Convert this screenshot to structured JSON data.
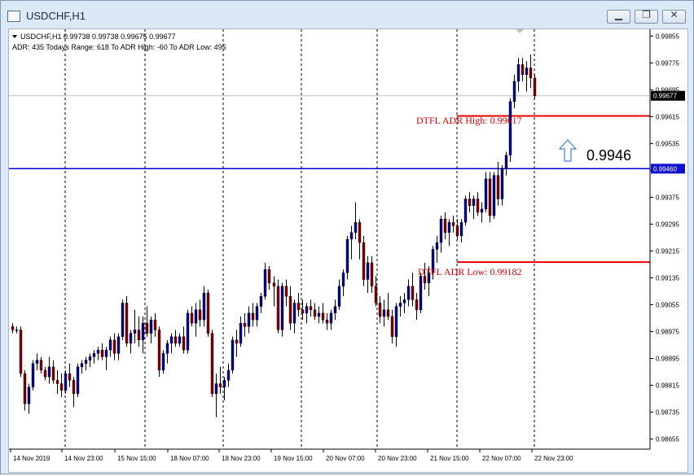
{
  "window": {
    "title": "USDCHF,H1"
  },
  "info": {
    "symbol_line": "USDCHF,H1  0.99738 0.99738 0.99675 0.99677",
    "adr_line": "ADR: 435  Todays Range: 618  To ADR High: -60  To ADR Low: 495"
  },
  "annotations": {
    "adr_high_label": "DTFL ADR High: 0.99617",
    "adr_low_label": "DTFL ADR Low: 0.99182",
    "level_label": "0.9946"
  },
  "colors": {
    "bull": "#000080",
    "bear": "#800000",
    "adr_line": "#e00000",
    "level_line": "#0000cc",
    "grid": "#000000"
  },
  "icons": {
    "target_arrow": "up-arrow-icon"
  },
  "chart_data": {
    "type": "candlestick",
    "symbol": "USDCHF",
    "timeframe": "H1",
    "ylim": [
      0.98625,
      0.99875
    ],
    "y_ticks": [
      "0.99855",
      "0.99775",
      "0.99695",
      "0.99615",
      "0.99535",
      "0.99455",
      "0.99375",
      "0.99295",
      "0.99215",
      "0.99135",
      "0.99055",
      "0.98975",
      "0.98895",
      "0.98815",
      "0.98735",
      "0.98655"
    ],
    "x_tick_labels": [
      "14 Nov 2019",
      "14 Nov 23:00",
      "15 Nov 15:00",
      "18 Nov 07:00",
      "18 Nov 23:00",
      "19 Nov 15:00",
      "20 Nov 07:00",
      "20 Nov 23:00",
      "21 Nov 15:00",
      "22 Nov 07:00",
      "22 Nov 23:00"
    ],
    "current_price": 0.99677,
    "current_price_label": "0.99677",
    "horizontal_level": 0.9946,
    "horizontal_level_label": "0.99460",
    "adr_high": 0.99617,
    "adr_low": 0.99182,
    "series": [
      {
        "values": [
          [
            0.9899,
            0.99,
            0.9897,
            0.9898
          ],
          [
            0.9898,
            0.9899,
            0.9897,
            0.9898
          ],
          [
            0.9898,
            0.9899,
            0.9884,
            0.9885
          ],
          [
            0.9885,
            0.9886,
            0.9874,
            0.9876
          ],
          [
            0.9876,
            0.9882,
            0.9873,
            0.9881
          ],
          [
            0.9881,
            0.9889,
            0.988,
            0.9888
          ],
          [
            0.9888,
            0.9891,
            0.9886,
            0.9889
          ],
          [
            0.9889,
            0.989,
            0.9885,
            0.9886
          ],
          [
            0.9886,
            0.9887,
            0.9883,
            0.9884
          ],
          [
            0.9884,
            0.989,
            0.9882,
            0.9887
          ],
          [
            0.9887,
            0.9889,
            0.9882,
            0.9883
          ],
          [
            0.9883,
            0.9886,
            0.9879,
            0.9882
          ],
          [
            0.9882,
            0.9885,
            0.9878,
            0.988
          ],
          [
            0.988,
            0.9886,
            0.9879,
            0.9885
          ],
          [
            0.9885,
            0.9888,
            0.9881,
            0.9883
          ],
          [
            0.9883,
            0.9884,
            0.9875,
            0.9879
          ],
          [
            0.9879,
            0.9888,
            0.9878,
            0.9887
          ],
          [
            0.9887,
            0.9889,
            0.9885,
            0.9888
          ],
          [
            0.9888,
            0.989,
            0.9886,
            0.9889
          ],
          [
            0.9889,
            0.9891,
            0.9887,
            0.989
          ],
          [
            0.989,
            0.9892,
            0.9888,
            0.9891
          ],
          [
            0.9891,
            0.9893,
            0.9889,
            0.9892
          ],
          [
            0.9892,
            0.9894,
            0.9889,
            0.989
          ],
          [
            0.989,
            0.9893,
            0.9886,
            0.9892
          ],
          [
            0.9892,
            0.9896,
            0.989,
            0.9895
          ],
          [
            0.9895,
            0.9897,
            0.9889,
            0.9891
          ],
          [
            0.9891,
            0.9897,
            0.9889,
            0.9896
          ],
          [
            0.9896,
            0.9907,
            0.9895,
            0.9906
          ],
          [
            0.9906,
            0.9908,
            0.9893,
            0.9894
          ],
          [
            0.9894,
            0.9898,
            0.9891,
            0.9897
          ],
          [
            0.9897,
            0.9904,
            0.9894,
            0.9898
          ],
          [
            0.9898,
            0.9902,
            0.9893,
            0.9895
          ],
          [
            0.9895,
            0.9902,
            0.9891,
            0.99
          ],
          [
            0.99,
            0.9905,
            0.9896,
            0.9897
          ],
          [
            0.9897,
            0.9902,
            0.9894,
            0.9901
          ],
          [
            0.9901,
            0.9903,
            0.9896,
            0.9898
          ],
          [
            0.9898,
            0.9899,
            0.9884,
            0.9886
          ],
          [
            0.9886,
            0.9892,
            0.9885,
            0.9891
          ],
          [
            0.9891,
            0.9895,
            0.9888,
            0.9894
          ],
          [
            0.9894,
            0.9897,
            0.9891,
            0.9896
          ],
          [
            0.9896,
            0.9898,
            0.9893,
            0.9894
          ],
          [
            0.9894,
            0.9897,
            0.9893,
            0.9896
          ],
          [
            0.9896,
            0.9899,
            0.9891,
            0.9892
          ],
          [
            0.9892,
            0.9904,
            0.9891,
            0.9903
          ],
          [
            0.9903,
            0.9905,
            0.9899,
            0.99
          ],
          [
            0.99,
            0.9906,
            0.9896,
            0.9904
          ],
          [
            0.9904,
            0.9907,
            0.9899,
            0.9901
          ],
          [
            0.9901,
            0.9911,
            0.9899,
            0.9909
          ],
          [
            0.9909,
            0.991,
            0.9896,
            0.9897
          ],
          [
            0.9897,
            0.9898,
            0.9878,
            0.9879
          ],
          [
            0.9879,
            0.9885,
            0.9872,
            0.9882
          ],
          [
            0.9882,
            0.9887,
            0.9879,
            0.9881
          ],
          [
            0.9881,
            0.9884,
            0.9877,
            0.9883
          ],
          [
            0.9883,
            0.9888,
            0.9881,
            0.9886
          ],
          [
            0.9886,
            0.9896,
            0.9885,
            0.9895
          ],
          [
            0.9895,
            0.9898,
            0.989,
            0.9894
          ],
          [
            0.9894,
            0.9902,
            0.9893,
            0.99
          ],
          [
            0.99,
            0.9903,
            0.9896,
            0.9899
          ],
          [
            0.9899,
            0.9905,
            0.9897,
            0.9903
          ],
          [
            0.9903,
            0.9906,
            0.9899,
            0.9901
          ],
          [
            0.9901,
            0.9906,
            0.9899,
            0.9905
          ],
          [
            0.9905,
            0.9909,
            0.9903,
            0.9908
          ],
          [
            0.9908,
            0.9918,
            0.9907,
            0.9916
          ],
          [
            0.9916,
            0.9917,
            0.991,
            0.9912
          ],
          [
            0.9912,
            0.9914,
            0.9905,
            0.9911
          ],
          [
            0.9911,
            0.9913,
            0.9897,
            0.9898
          ],
          [
            0.9898,
            0.9912,
            0.9896,
            0.9911
          ],
          [
            0.9911,
            0.9913,
            0.9905,
            0.9908
          ],
          [
            0.9908,
            0.9911,
            0.9898,
            0.99
          ],
          [
            0.99,
            0.9907,
            0.9897,
            0.9906
          ],
          [
            0.9906,
            0.9909,
            0.9902,
            0.9904
          ],
          [
            0.9904,
            0.9907,
            0.9901,
            0.9903
          ],
          [
            0.9903,
            0.9906,
            0.99,
            0.9905
          ],
          [
            0.9905,
            0.9907,
            0.9902,
            0.9904
          ],
          [
            0.9904,
            0.9906,
            0.9901,
            0.9902
          ],
          [
            0.9902,
            0.9905,
            0.99,
            0.9903
          ],
          [
            0.9903,
            0.9906,
            0.99,
            0.9901
          ],
          [
            0.9901,
            0.9903,
            0.9898,
            0.99
          ],
          [
            0.99,
            0.9904,
            0.9898,
            0.9903
          ],
          [
            0.9903,
            0.9907,
            0.9901,
            0.9905
          ],
          [
            0.9905,
            0.9913,
            0.9904,
            0.9911
          ],
          [
            0.9911,
            0.9916,
            0.9908,
            0.9915
          ],
          [
            0.9915,
            0.9926,
            0.9913,
            0.9925
          ],
          [
            0.9925,
            0.9929,
            0.9919,
            0.9927
          ],
          [
            0.9927,
            0.9936,
            0.9925,
            0.993
          ],
          [
            0.993,
            0.9931,
            0.9919,
            0.9924
          ],
          [
            0.9924,
            0.9926,
            0.9911,
            0.9913
          ],
          [
            0.9913,
            0.992,
            0.9909,
            0.9918
          ],
          [
            0.9918,
            0.992,
            0.9909,
            0.9911
          ],
          [
            0.9911,
            0.9914,
            0.9905,
            0.9906
          ],
          [
            0.9906,
            0.9908,
            0.99,
            0.9902
          ],
          [
            0.9902,
            0.9907,
            0.9899,
            0.9904
          ],
          [
            0.9904,
            0.9909,
            0.9901,
            0.9902
          ],
          [
            0.9902,
            0.9904,
            0.9894,
            0.9896
          ],
          [
            0.9896,
            0.9906,
            0.9893,
            0.9905
          ],
          [
            0.9905,
            0.9908,
            0.9902,
            0.9906
          ],
          [
            0.9906,
            0.9909,
            0.9903,
            0.9907
          ],
          [
            0.9907,
            0.9913,
            0.9905,
            0.9911
          ],
          [
            0.9911,
            0.9915,
            0.9905,
            0.9907
          ],
          [
            0.9907,
            0.9909,
            0.9901,
            0.9904
          ],
          [
            0.9904,
            0.9915,
            0.9903,
            0.9914
          ],
          [
            0.9914,
            0.9918,
            0.991,
            0.9912
          ],
          [
            0.9912,
            0.9917,
            0.9908,
            0.9915
          ],
          [
            0.9915,
            0.9923,
            0.9913,
            0.9922
          ],
          [
            0.9922,
            0.9926,
            0.9918,
            0.9924
          ],
          [
            0.9924,
            0.9932,
            0.9921,
            0.9931
          ],
          [
            0.9931,
            0.9933,
            0.9925,
            0.9927
          ],
          [
            0.9927,
            0.9931,
            0.9923,
            0.993
          ],
          [
            0.993,
            0.9932,
            0.9927,
            0.9929
          ],
          [
            0.9929,
            0.9931,
            0.9925,
            0.9926
          ],
          [
            0.9926,
            0.9931,
            0.9924,
            0.993
          ],
          [
            0.993,
            0.9938,
            0.9929,
            0.9937
          ],
          [
            0.9937,
            0.9939,
            0.9933,
            0.9935
          ],
          [
            0.9935,
            0.9938,
            0.9931,
            0.9937
          ],
          [
            0.9937,
            0.9939,
            0.9932,
            0.9933
          ],
          [
            0.9933,
            0.9936,
            0.993,
            0.9934
          ],
          [
            0.9934,
            0.9945,
            0.9933,
            0.9943
          ],
          [
            0.9943,
            0.9945,
            0.993,
            0.9932
          ],
          [
            0.9932,
            0.9945,
            0.9931,
            0.9944
          ],
          [
            0.9944,
            0.9948,
            0.9935,
            0.9937
          ],
          [
            0.9937,
            0.9947,
            0.9935,
            0.9946
          ],
          [
            0.9946,
            0.9951,
            0.9944,
            0.995
          ],
          [
            0.995,
            0.9967,
            0.9948,
            0.9966
          ],
          [
            0.9966,
            0.9974,
            0.9964,
            0.9972
          ],
          [
            0.9972,
            0.9979,
            0.9969,
            0.9977
          ],
          [
            0.9977,
            0.9979,
            0.9972,
            0.9974
          ],
          [
            0.9974,
            0.9978,
            0.9969,
            0.9976
          ],
          [
            0.9976,
            0.998,
            0.997,
            0.9973
          ],
          [
            0.9973,
            0.9974,
            0.9967,
            0.99677
          ]
        ]
      }
    ]
  }
}
